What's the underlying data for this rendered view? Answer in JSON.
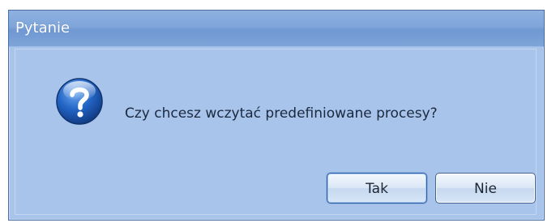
{
  "window": {
    "title": "Pytanie"
  },
  "dialog": {
    "message": "Czy chcesz wczytać predefiniowane procesy?",
    "icon": "question-icon"
  },
  "buttons": {
    "yes_label": "Tak",
    "no_label": "Nie"
  },
  "colors": {
    "titlebar": "#7fa5da",
    "background": "#a9c4ea",
    "icon": "#1f5bb5"
  }
}
